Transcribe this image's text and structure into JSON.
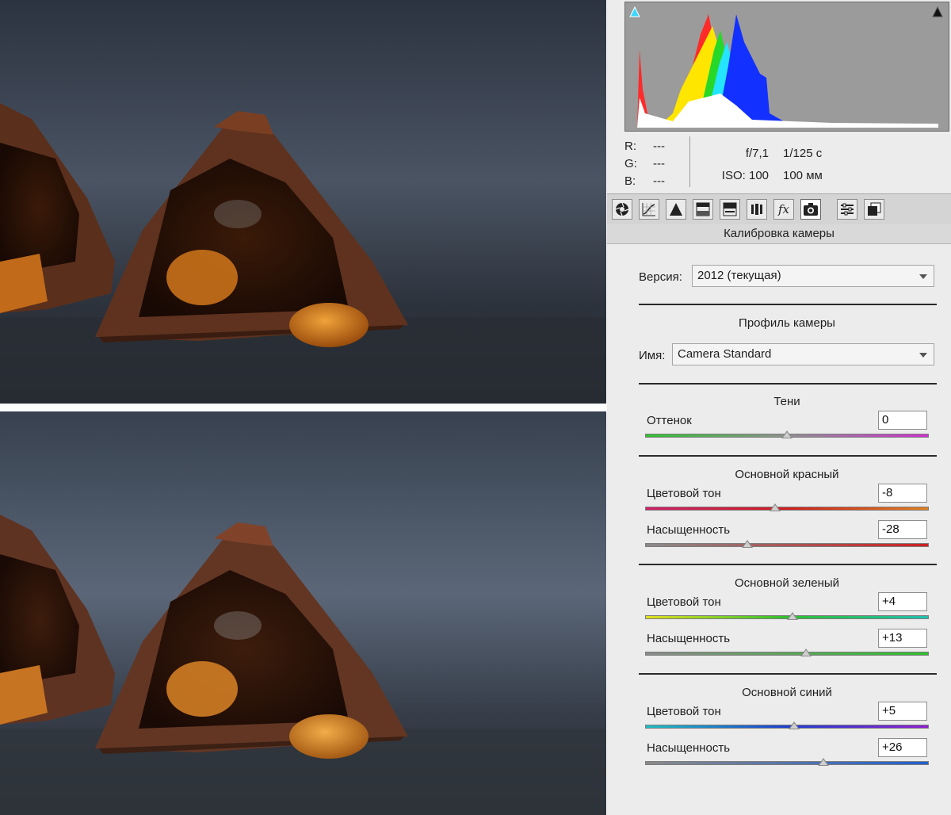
{
  "photos": {
    "before": "photo-before",
    "after": "photo-after"
  },
  "histogram": {
    "colors": [
      "#ff1e1e",
      "#ffe600",
      "#00c800",
      "#00e5ff",
      "#0a28ff",
      "#ffffff"
    ]
  },
  "readout": {
    "r_label": "R:",
    "r_value": "---",
    "g_label": "G:",
    "g_value": "---",
    "b_label": "B:",
    "b_value": "---",
    "aperture": "f/7,1",
    "shutter": "1/125 с",
    "iso": "ISO: 100",
    "focal": "100 мм"
  },
  "toolbar": {
    "icons": [
      "basic-aperture-icon",
      "tone-curve-icon",
      "detail-icon",
      "hsl-icon",
      "split-toning-icon",
      "lens-icon",
      "fx-icon",
      "camera-calibration-icon",
      "presets-icon",
      "snapshots-icon"
    ],
    "fx_text": "fx"
  },
  "calibration": {
    "title": "Калибровка камеры",
    "version_label": "Версия:",
    "version_value": "2012 (текущая)",
    "profile_heading": "Профиль камеры",
    "name_label": "Имя:",
    "name_value": "Camera Standard",
    "shadows": {
      "heading": "Тени",
      "tint_label": "Оттенок",
      "tint_value": "0"
    },
    "red": {
      "heading": "Основной красный",
      "hue_label": "Цветовой тон",
      "hue_value": "-8",
      "sat_label": "Насыщенность",
      "sat_value": "-28"
    },
    "green": {
      "heading": "Основной зеленый",
      "hue_label": "Цветовой тон",
      "hue_value": "+4",
      "sat_label": "Насыщенность",
      "sat_value": "+13"
    },
    "blue": {
      "heading": "Основной синий",
      "hue_label": "Цветовой тон",
      "hue_value": "+5",
      "sat_label": "Насыщенность",
      "sat_value": "+26"
    }
  }
}
